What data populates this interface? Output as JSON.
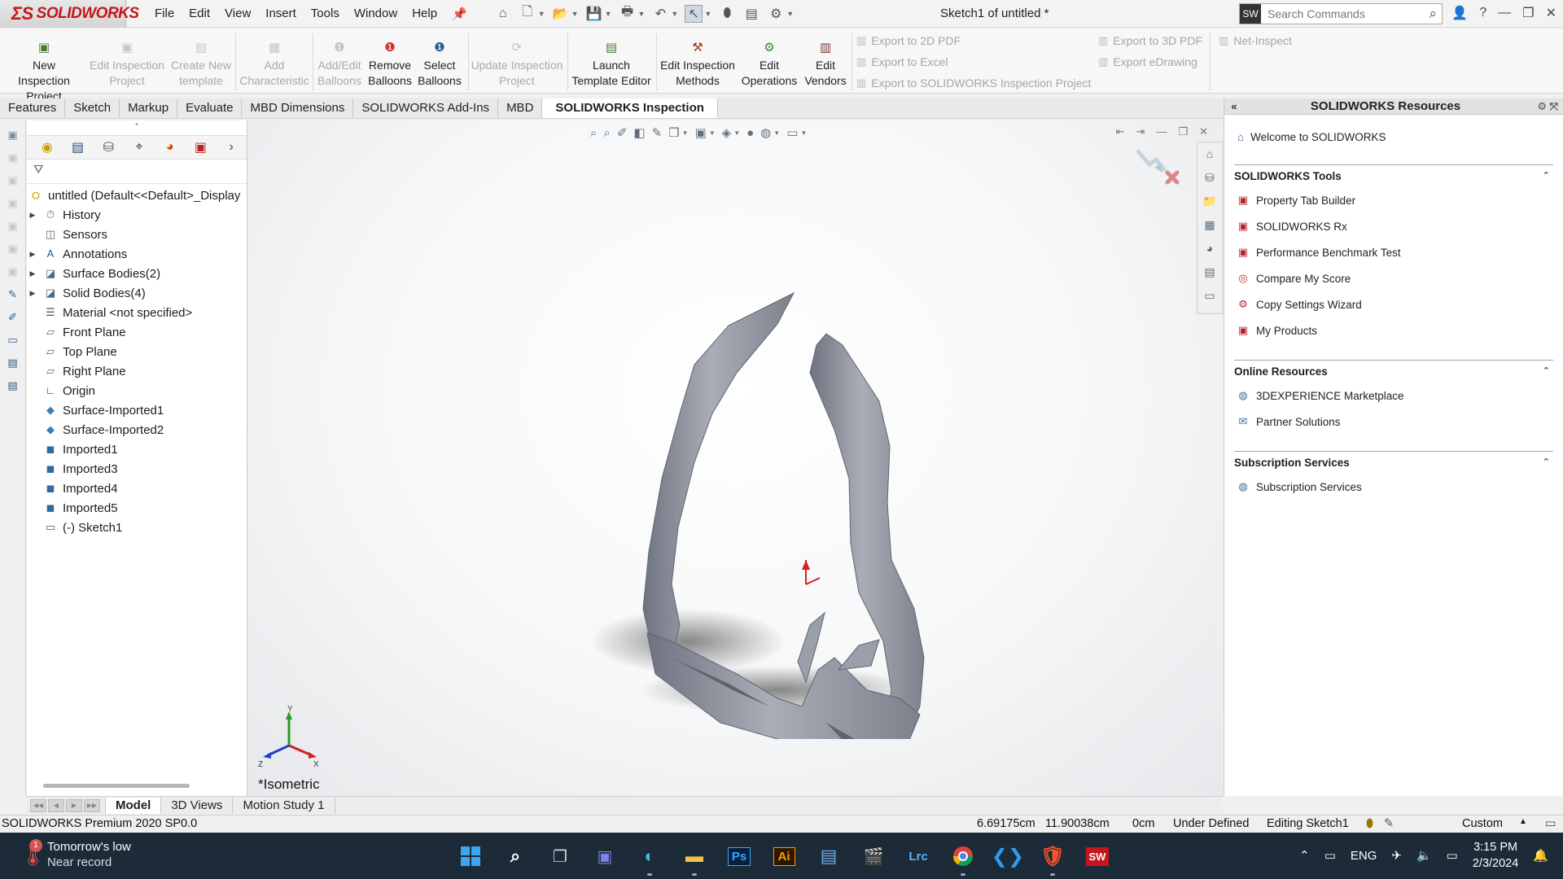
{
  "app": {
    "brand": "SOLIDWORKS",
    "document_title": "Sketch1 of untitled *",
    "menus": [
      "File",
      "Edit",
      "View",
      "Insert",
      "Tools",
      "Window",
      "Help"
    ],
    "search_placeholder": "Search Commands"
  },
  "commands": {
    "new_inspection_project": [
      "New Inspection",
      "Project"
    ],
    "edit_inspection_project": [
      "Edit Inspection",
      "Project"
    ],
    "create_new_template": [
      "Create New",
      "template"
    ],
    "add_characteristic": [
      "Add",
      "Characteristic"
    ],
    "add_edit_balloons": [
      "Add/Edit",
      "Balloons"
    ],
    "remove_balloons": [
      "Remove",
      "Balloons"
    ],
    "select_balloons": [
      "Select",
      "Balloons"
    ],
    "update_inspection_project": [
      "Update Inspection",
      "Project"
    ],
    "launch_template_editor": [
      "Launch",
      "Template Editor"
    ],
    "edit_inspection_methods": [
      "Edit Inspection",
      "Methods"
    ],
    "edit_operations": [
      "Edit",
      "Operations"
    ],
    "edit_vendors": [
      "Edit",
      "Vendors"
    ],
    "export_2d_pdf": "Export to 2D PDF",
    "export_excel": "Export to Excel",
    "export_inspection_project": "Export to SOLIDWORKS Inspection Project",
    "export_3d_pdf": "Export to 3D PDF",
    "export_edrawing": "Export eDrawing",
    "net_inspect": "Net-Inspect"
  },
  "tabs": [
    "Features",
    "Sketch",
    "Markup",
    "Evaluate",
    "MBD Dimensions",
    "SOLIDWORKS Add-Ins",
    "MBD",
    "SOLIDWORKS Inspection"
  ],
  "active_tab": "SOLIDWORKS Inspection",
  "tree": {
    "root": "untitled  (Default<<Default>_Display",
    "items": [
      {
        "label": "History",
        "expand": true,
        "icon": "history-icon"
      },
      {
        "label": "Sensors",
        "expand": false,
        "icon": "sensor-icon"
      },
      {
        "label": "Annotations",
        "expand": true,
        "icon": "annotations-icon"
      },
      {
        "label": "Surface Bodies(2)",
        "expand": true,
        "icon": "surface-bodies-icon"
      },
      {
        "label": "Solid Bodies(4)",
        "expand": true,
        "icon": "solid-bodies-icon"
      },
      {
        "label": "Material <not specified>",
        "expand": false,
        "icon": "material-icon"
      },
      {
        "label": "Front Plane",
        "expand": false,
        "icon": "plane-icon"
      },
      {
        "label": "Top Plane",
        "expand": false,
        "icon": "plane-icon"
      },
      {
        "label": "Right Plane",
        "expand": false,
        "icon": "plane-icon"
      },
      {
        "label": "Origin",
        "expand": false,
        "icon": "origin-icon"
      },
      {
        "label": "Surface-Imported1",
        "expand": false,
        "icon": "surface-imported-icon"
      },
      {
        "label": "Surface-Imported2",
        "expand": false,
        "icon": "surface-imported-icon"
      },
      {
        "label": "Imported1",
        "expand": false,
        "icon": "imported-body-icon"
      },
      {
        "label": "Imported3",
        "expand": false,
        "icon": "imported-body-icon"
      },
      {
        "label": "Imported4",
        "expand": false,
        "icon": "imported-body-icon"
      },
      {
        "label": "Imported5",
        "expand": false,
        "icon": "imported-body-icon"
      },
      {
        "label": "(-) Sketch1",
        "expand": false,
        "icon": "sketch-icon"
      }
    ]
  },
  "viewport": {
    "view_label": "*Isometric",
    "triad": {
      "x": "X",
      "y": "Y",
      "z": "Z"
    }
  },
  "task_pane": {
    "title": "SOLIDWORKS Resources",
    "welcome": "Welcome to SOLIDWORKS",
    "sections": [
      {
        "title": "SOLIDWORKS Tools",
        "items": [
          "Property Tab Builder",
          "SOLIDWORKS Rx",
          "Performance Benchmark Test",
          "Compare My Score",
          "Copy Settings Wizard",
          "My Products"
        ]
      },
      {
        "title": "Online Resources",
        "items": [
          "3DEXPERIENCE Marketplace",
          "Partner Solutions"
        ]
      },
      {
        "title": "Subscription Services",
        "items": [
          "Subscription Services"
        ]
      }
    ]
  },
  "bottom_tabs": [
    "Model",
    "3D Views",
    "Motion Study 1"
  ],
  "status": {
    "product": "SOLIDWORKS Premium 2020 SP0.0",
    "x": "6.69175cm",
    "y": "11.90038cm",
    "z": "0cm",
    "state": "Under Defined",
    "editing": "Editing Sketch1",
    "units": "Custom"
  },
  "taskbar": {
    "weather_line1": "Tomorrow's low",
    "weather_line2": "Near record",
    "weather_badge": "1",
    "apps": [
      "Start",
      "Search",
      "Task View",
      "Teams",
      "Edge",
      "File Explorer",
      "Ps",
      "Ai",
      "Notepad",
      "Movie Maker",
      "Lrc",
      "Chrome",
      "VS Code",
      "Brave",
      "SW"
    ],
    "language": "ENG",
    "time": "3:15 PM",
    "date": "2/3/2024"
  },
  "colors": {
    "brand_red": "#c4161c",
    "model_gray": "#8a8f9a",
    "taskbar_bg": "#1d2a38"
  }
}
